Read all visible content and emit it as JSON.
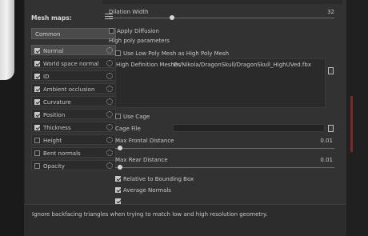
{
  "sidebar": {
    "title": "Mesh maps:",
    "preset": "Common",
    "items": [
      {
        "label": "Normal",
        "checked": true,
        "active": true
      },
      {
        "label": "World space normal",
        "checked": true
      },
      {
        "label": "ID",
        "checked": true
      },
      {
        "label": "Ambient occlusion",
        "checked": true
      },
      {
        "label": "Curvature",
        "checked": true
      },
      {
        "label": "Position",
        "checked": true
      },
      {
        "label": "Thickness",
        "checked": true
      },
      {
        "label": "Height",
        "checked": false
      },
      {
        "label": "Bent normals",
        "checked": false
      },
      {
        "label": "Opacity",
        "checked": false
      }
    ]
  },
  "main": {
    "dilation_label": "Dilation Width",
    "dilation_value": "32",
    "dilation_fraction": 0.28,
    "apply_diffusion": "Apply Diffusion",
    "high_poly_header": "High poly parameters",
    "use_low_poly": "Use Low Poly Mesh as High Poly Mesh",
    "hd_meshes_label": "High Definition Meshes",
    "hd_meshes_value": "D:/Nikola/DragonSkull/DragonSkull_HighUVed.fbx",
    "use_cage": "Use Cage",
    "cage_file": "Cage File",
    "max_frontal_label": "Max Frontal Distance",
    "max_frontal_value": "0.01",
    "max_rear_label": "Max Rear Distance",
    "max_rear_value": "0.01",
    "relative_bb": "Relative to Bounding Box",
    "average_normals": "Average Normals"
  },
  "status": {
    "text": "Ignore backfacing triangles when trying to match low and high resolution geometry."
  }
}
